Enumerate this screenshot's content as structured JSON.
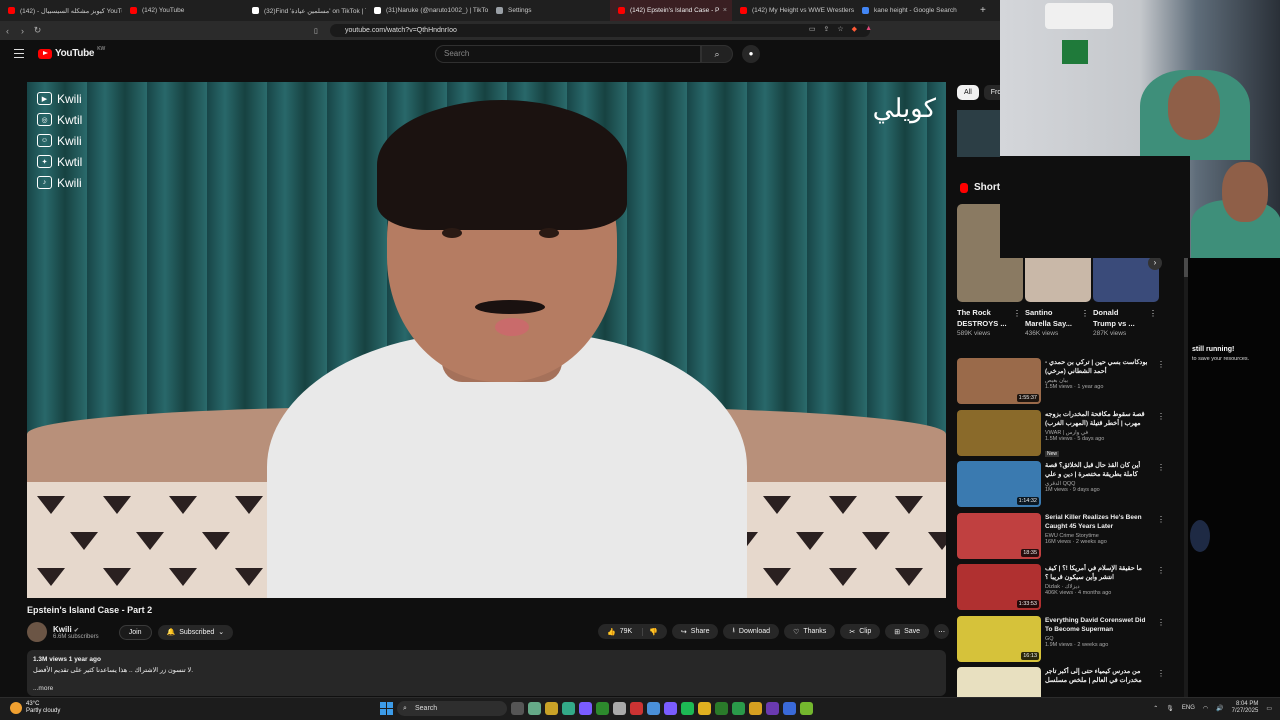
{
  "browser": {
    "tabs": [
      {
        "title": "كيوبز مشكله السيسبيال - (142) YouTube",
        "color": "#ff0000"
      },
      {
        "title": "(142) YouTube",
        "color": "#ff0000"
      },
      {
        "title": "(32)Find 'مسلمين عيادة' on TikTok | Ti",
        "color": "#ffffff"
      },
      {
        "title": "(31)Naruke (@naruto1002_) | TikTok",
        "color": "#ffffff"
      },
      {
        "title": "Settings",
        "color": "#9aa0a6"
      },
      {
        "title": "(142) Epstein's Island Case - P",
        "color": "#ff0000",
        "active": true
      },
      {
        "title": "(142) My Height vs WWE Wrestlers",
        "color": "#ff0000"
      },
      {
        "title": "kane height - Google Search",
        "color": "#4285f4"
      }
    ],
    "tab_close": "×",
    "new_tab": "+",
    "url": "youtube.com/watch?v=QthHndnrIoo"
  },
  "youtube": {
    "logo_text": "YouTube",
    "country": "KW",
    "search_placeholder": "Search"
  },
  "video": {
    "socials": [
      {
        "icon": "youtube-icon",
        "label": "Kwili"
      },
      {
        "icon": "instagram-icon",
        "label": "Kwtil"
      },
      {
        "icon": "snapchat-icon",
        "label": "Kwili"
      },
      {
        "icon": "twitter-icon",
        "label": "Kwtil"
      },
      {
        "icon": "tiktok-icon",
        "label": "Kwili"
      }
    ],
    "watermark": "كويلي",
    "title": "Epstein's Island Case - Part 2",
    "channel": "Kwili",
    "subscribers": "6.6M subscribers",
    "join": "Join",
    "subscribed": "Subscribed",
    "likes": "79K",
    "share": "Share",
    "download": "Download",
    "thanks": "Thanks",
    "clip": "Clip",
    "save": "Save",
    "views_date": "1.3M views  1 year ago",
    "description": "لا تنسون زر الاشتراك .. هذا يساعدنا كثير على تقديم الأفضل.",
    "more": "...more"
  },
  "sidebar": {
    "chips": [
      "All",
      "From"
    ],
    "shorts_title": "Shorts",
    "shorts": [
      {
        "title_line1": "The Rock",
        "title_line2": "DESTROYS ...",
        "views": "589K views",
        "color": "#8a7a62"
      },
      {
        "title_line1": "Santino",
        "title_line2": "Marella Say...",
        "views": "436K views",
        "color": "#c9b8a8"
      },
      {
        "title_line1": "Donald",
        "title_line2": "Trump vs ...",
        "views": "287K views",
        "color": "#3a4b7a"
      }
    ],
    "recommendations": [
      {
        "title": "بودكاست بسي حين | تركي بن حمدي - أحمد الشطاني (مرخي)",
        "channel": "بيان بغيص",
        "meta": "1.5M views · 1 year ago",
        "duration": "1:55:37",
        "color": "#9a6a4a"
      },
      {
        "title": "قصة سقوط مكافحة المخدرات بزوجه مهرب | أخطر قتيلة (المهرب الغرب)",
        "channel": "VWAR | في وارس",
        "meta": "1.5M views · 5 days ago",
        "duration": "",
        "new": "New",
        "color": "#8a6a2a"
      },
      {
        "title": "أين كان القذ حال قبل الخلائق؟ قصة كاملة بطريقة مختصرة | دين و علي",
        "channel": "الدقري QQQ",
        "meta": "1M views · 9 days ago",
        "duration": "1:14:32",
        "color": "#3a7ab0"
      },
      {
        "title": "Serial Killer Realizes He's Been Caught 45 Years Later",
        "channel": "EWU Crime Storytime",
        "meta": "16M views · 2 weeks ago",
        "duration": "18:35",
        "color": "#c04040"
      },
      {
        "title": "ما حقيقة الإسلام في أمريكا !؟ | كيف انتشر وأين سيكون قريبا ؟",
        "channel": "Dizlak · ديزلاك",
        "meta": "406K views · 4 months ago",
        "duration": "1:33:53",
        "color": "#b03030"
      },
      {
        "title": "Everything David Corenswet Did To Become Superman",
        "channel": "GQ",
        "meta": "1.9M views · 2 weeks ago",
        "duration": "16:13",
        "color": "#d6c23a"
      },
      {
        "title": "من مدرس كيمياء حتى إلى أكبر تاجر مخدرات في العالم | ملخص مسلسل Breakin...",
        "channel": "",
        "meta": "",
        "duration": "",
        "color": "#e8e0c0"
      }
    ],
    "more_icon": "⋮"
  },
  "webcam_overlay": {
    "text_title": "still running!",
    "text_sub": "to save your resources."
  },
  "taskbar": {
    "temp": "43°C",
    "weather": "Partly cloudy",
    "search": "Search",
    "time": "8:04 PM",
    "date": "7/27/2025",
    "tray_lang": "ENG"
  },
  "colors": {
    "bg": "#0f0f0f",
    "accent": "#ff0000",
    "chip": "#272727"
  }
}
